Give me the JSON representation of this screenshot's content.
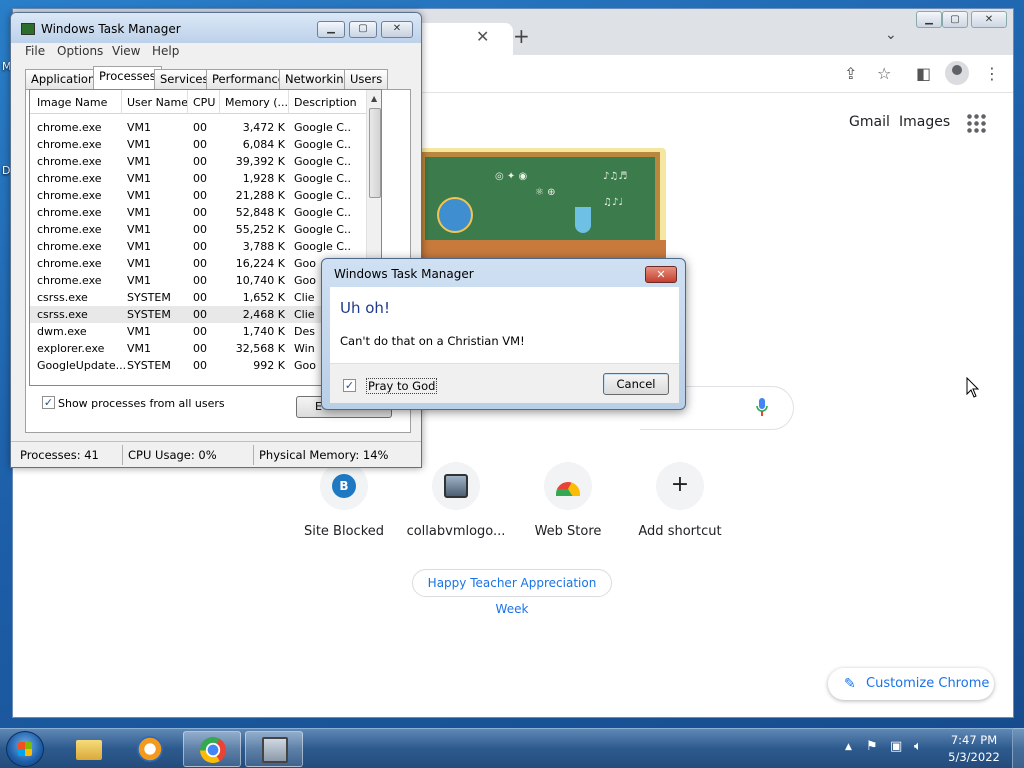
{
  "desktop": {
    "left_icon_fragments": [
      "M",
      "D"
    ]
  },
  "chrome": {
    "tab_close_glyph": "✕",
    "new_tab_glyph": "+",
    "header_links": [
      "Gmail",
      "Images"
    ],
    "shortcuts": [
      {
        "label": "Site Blocked",
        "icon": "letter-b-favicon",
        "letter": "B"
      },
      {
        "label": "collabvmlogo...",
        "icon": "collabvm-favicon"
      },
      {
        "label": "Web Store",
        "icon": "webstore-icon"
      },
      {
        "label": "Add shortcut",
        "icon": "plus-icon",
        "glyph": "+"
      }
    ],
    "doodle_chip": "Happy Teacher Appreciation Week",
    "customize_label": "Customize Chrome",
    "accent": "#1a73e8"
  },
  "taskmgr": {
    "title": "Windows Task Manager",
    "menu": [
      "File",
      "Options",
      "View",
      "Help"
    ],
    "tabs": [
      "Applications",
      "Processes",
      "Services",
      "Performance",
      "Networking",
      "Users"
    ],
    "active_tab": "Processes",
    "columns": [
      "Image Name",
      "User Name",
      "CPU",
      "Memory (...",
      "Description"
    ],
    "rows": [
      [
        "chrome.exe",
        "VM1",
        "00",
        "3,472 K",
        "Google C..."
      ],
      [
        "chrome.exe",
        "VM1",
        "00",
        "6,084 K",
        "Google C..."
      ],
      [
        "chrome.exe",
        "VM1",
        "00",
        "39,392 K",
        "Google C..."
      ],
      [
        "chrome.exe",
        "VM1",
        "00",
        "1,928 K",
        "Google C..."
      ],
      [
        "chrome.exe",
        "VM1",
        "00",
        "21,288 K",
        "Google C..."
      ],
      [
        "chrome.exe",
        "VM1",
        "00",
        "52,848 K",
        "Google C..."
      ],
      [
        "chrome.exe",
        "VM1",
        "00",
        "55,252 K",
        "Google C..."
      ],
      [
        "chrome.exe",
        "VM1",
        "00",
        "3,788 K",
        "Google C..."
      ],
      [
        "chrome.exe",
        "VM1",
        "00",
        "16,224 K",
        "Goo"
      ],
      [
        "chrome.exe",
        "VM1",
        "00",
        "10,740 K",
        "Goo"
      ],
      [
        "csrss.exe",
        "SYSTEM",
        "00",
        "1,652 K",
        "Clie"
      ],
      [
        "csrss.exe",
        "SYSTEM",
        "00",
        "2,468 K",
        "Clie"
      ],
      [
        "dwm.exe",
        "VM1",
        "00",
        "1,740 K",
        "Des"
      ],
      [
        "explorer.exe",
        "VM1",
        "00",
        "32,568 K",
        "Win"
      ],
      [
        "GoogleUpdate...",
        "SYSTEM",
        "00",
        "992 K",
        "Goo"
      ]
    ],
    "selected_row": 11,
    "show_all_label": "Show processes from all users",
    "show_all_checked": true,
    "end_button_fragment": "E",
    "status": {
      "processes": "Processes: 41",
      "cpu": "CPU Usage: 0%",
      "memory": "Physical Memory: 14%"
    }
  },
  "dialog": {
    "title": "Windows Task Manager",
    "close_glyph": "✕",
    "main_instruction": "Uh oh!",
    "message": "Can't do that on a Christian VM!",
    "verification_label": "Pray to God",
    "verification_checked": true,
    "cancel_label": "Cancel"
  },
  "taskbar": {
    "pinned": [
      {
        "name": "explorer",
        "icon": "folder-icon"
      },
      {
        "name": "media-player",
        "icon": "media-player-icon"
      },
      {
        "name": "chrome",
        "icon": "chrome-icon",
        "active": true
      },
      {
        "name": "task-manager",
        "icon": "task-manager-icon",
        "active": true
      }
    ],
    "tray_arrow": "▲",
    "time": "7:47 PM",
    "date": "5/3/2022"
  }
}
